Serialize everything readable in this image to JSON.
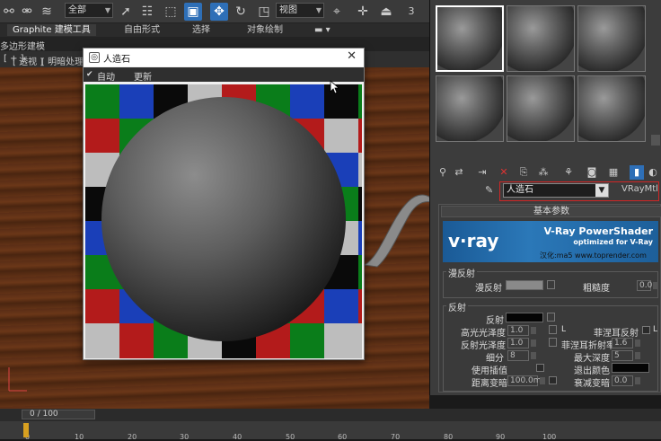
{
  "toolbar": {
    "selection_filter": "全部",
    "coord_system": "视图",
    "snap_value": "3"
  },
  "ribbon": {
    "tabs": [
      "Graphite 建模工具",
      "自由形式",
      "选择",
      "对象绘制"
    ],
    "subpanel_label": "多边形建模"
  },
  "viewport": {
    "labels": [
      "[ + ]",
      "[ 透视 ]",
      "[ 明暗处理 ]"
    ]
  },
  "preview_window": {
    "title": "人造石",
    "auto_label": "自动",
    "update_label": "更新",
    "close_glyph": "✕",
    "check_glyph": "✔"
  },
  "material_editor": {
    "material_name": "人造石",
    "material_type": "VRayMtl",
    "rollout_title": "基本参数",
    "banner": {
      "logo": "v·ray",
      "title": "V-Ray PowerShader",
      "subtitle": "optimized for V-Ray",
      "credit": "汉化:ma5 www.toprender.com"
    },
    "diffuse": {
      "group": "漫反射",
      "diffuse_label": "漫反射",
      "roughness_label": "粗糙度",
      "roughness_value": "0.0"
    },
    "reflection": {
      "group": "反射",
      "reflect_label": "反射",
      "hilight_gloss_label": "高光光泽度",
      "hilight_gloss_value": "1.0",
      "lock_label": "L",
      "refl_gloss_label": "反射光泽度",
      "refl_gloss_value": "1.0",
      "subdivs_label": "细分",
      "subdivs_value": "8",
      "use_interp_label": "使用插值",
      "dim_distance_label": "距离变暗",
      "dim_distance_value": "100.0m",
      "fresnel_label": "菲涅耳反射",
      "fresnel_lock": "L",
      "fresnel_ior_label": "菲涅耳折射率",
      "fresnel_ior_value": "1.6",
      "max_depth_label": "最大深度",
      "max_depth_value": "5",
      "exit_color_label": "退出颜色",
      "dim_falloff_label": "衰减变暗",
      "dim_falloff_value": "0.0"
    }
  },
  "timeline": {
    "frame_counter": "0 / 100",
    "ticks": [
      "0",
      "10",
      "20",
      "30",
      "40",
      "50",
      "60",
      "70",
      "80",
      "90",
      "100"
    ]
  },
  "colors": {
    "accent": "#2e6fb7",
    "highlight_border": "#d02626",
    "vray_blue": "#1f66a8"
  },
  "icons": [
    "link-icon",
    "unlink-icon",
    "bind-spacewarp-icon",
    "select-object-icon",
    "select-by-name-icon",
    "rect-select-icon",
    "window-crossing-icon",
    "move-icon",
    "rotate-icon",
    "scale-icon",
    "pivot-icon",
    "snap-icon",
    "close-icon"
  ]
}
